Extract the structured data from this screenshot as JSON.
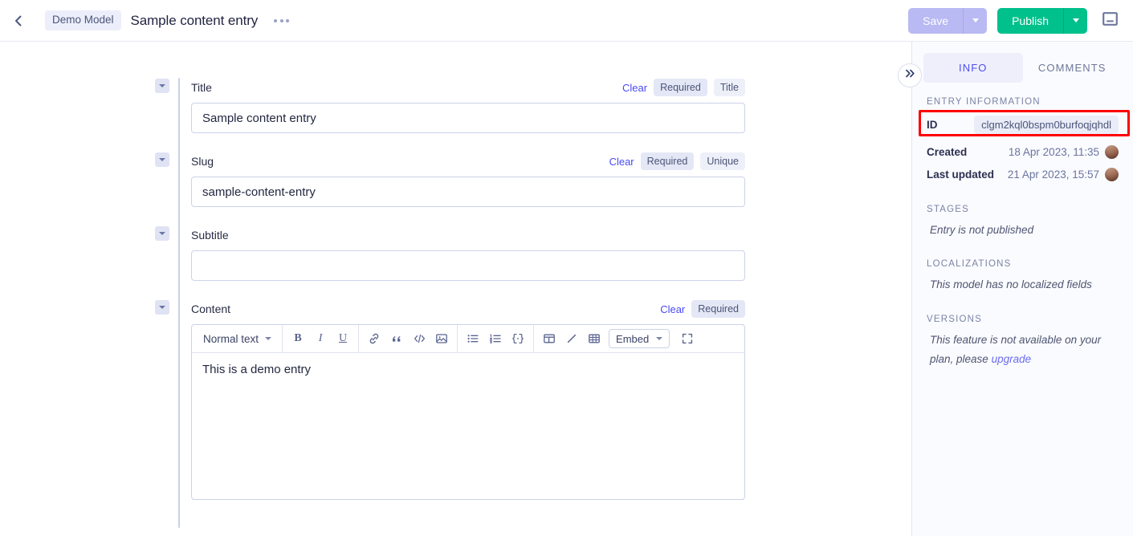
{
  "topbar": {
    "back_icon": "chevron-left-icon",
    "model_chip": "Demo Model",
    "entry_title": "Sample content entry",
    "more_icon": "ellipsis-icon",
    "save_label": "Save",
    "publish_label": "Publish",
    "panel_toggle_icon": "panel-toggle-icon",
    "save_color": "#b9b9f3",
    "publish_color": "#00c08b"
  },
  "fields": [
    {
      "label": "Title",
      "value": "Sample content entry",
      "clear": "Clear",
      "badges": [
        "Required",
        "Title"
      ]
    },
    {
      "label": "Slug",
      "value": "sample-content-entry",
      "clear": "Clear",
      "badges": [
        "Required",
        "Unique"
      ]
    },
    {
      "label": "Subtitle",
      "value": "",
      "clear": "",
      "badges": []
    },
    {
      "label": "Content",
      "value": "This is a demo entry",
      "clear": "Clear",
      "badges": [
        "Required"
      ]
    }
  ],
  "editor": {
    "style_select": "Normal text",
    "embed_label": "Embed",
    "tools": [
      "bold-icon",
      "italic-icon",
      "underline-icon",
      "link-icon",
      "blockquote-icon",
      "inline-code-icon",
      "image-icon",
      "bullet-list-icon",
      "numbered-list-icon",
      "code-block-icon",
      "columns-icon",
      "divider-icon",
      "table-icon",
      "fullscreen-icon"
    ],
    "content_text": "This is a demo entry"
  },
  "sidebar": {
    "collapse_icon": "chevrons-right-icon",
    "tabs": [
      {
        "label": "INFO",
        "active": true
      },
      {
        "label": "COMMENTS",
        "active": false
      }
    ],
    "entry_information": {
      "title": "ENTRY INFORMATION",
      "id_label": "ID",
      "id_value": "clgm2kql0bspm0burfoqjqhdl",
      "created_label": "Created",
      "created_value": "18 Apr 2023, 11:35",
      "updated_label": "Last updated",
      "updated_value": "21 Apr 2023, 15:57"
    },
    "stages": {
      "title": "STAGES",
      "note": "Entry is not published"
    },
    "localizations": {
      "title": "LOCALIZATIONS",
      "note": "This model has no localized fields"
    },
    "versions": {
      "title": "VERSIONS",
      "note_prefix": "This feature is not available on your plan, please ",
      "note_link": "upgrade"
    },
    "highlight_color": "#ff0000"
  }
}
